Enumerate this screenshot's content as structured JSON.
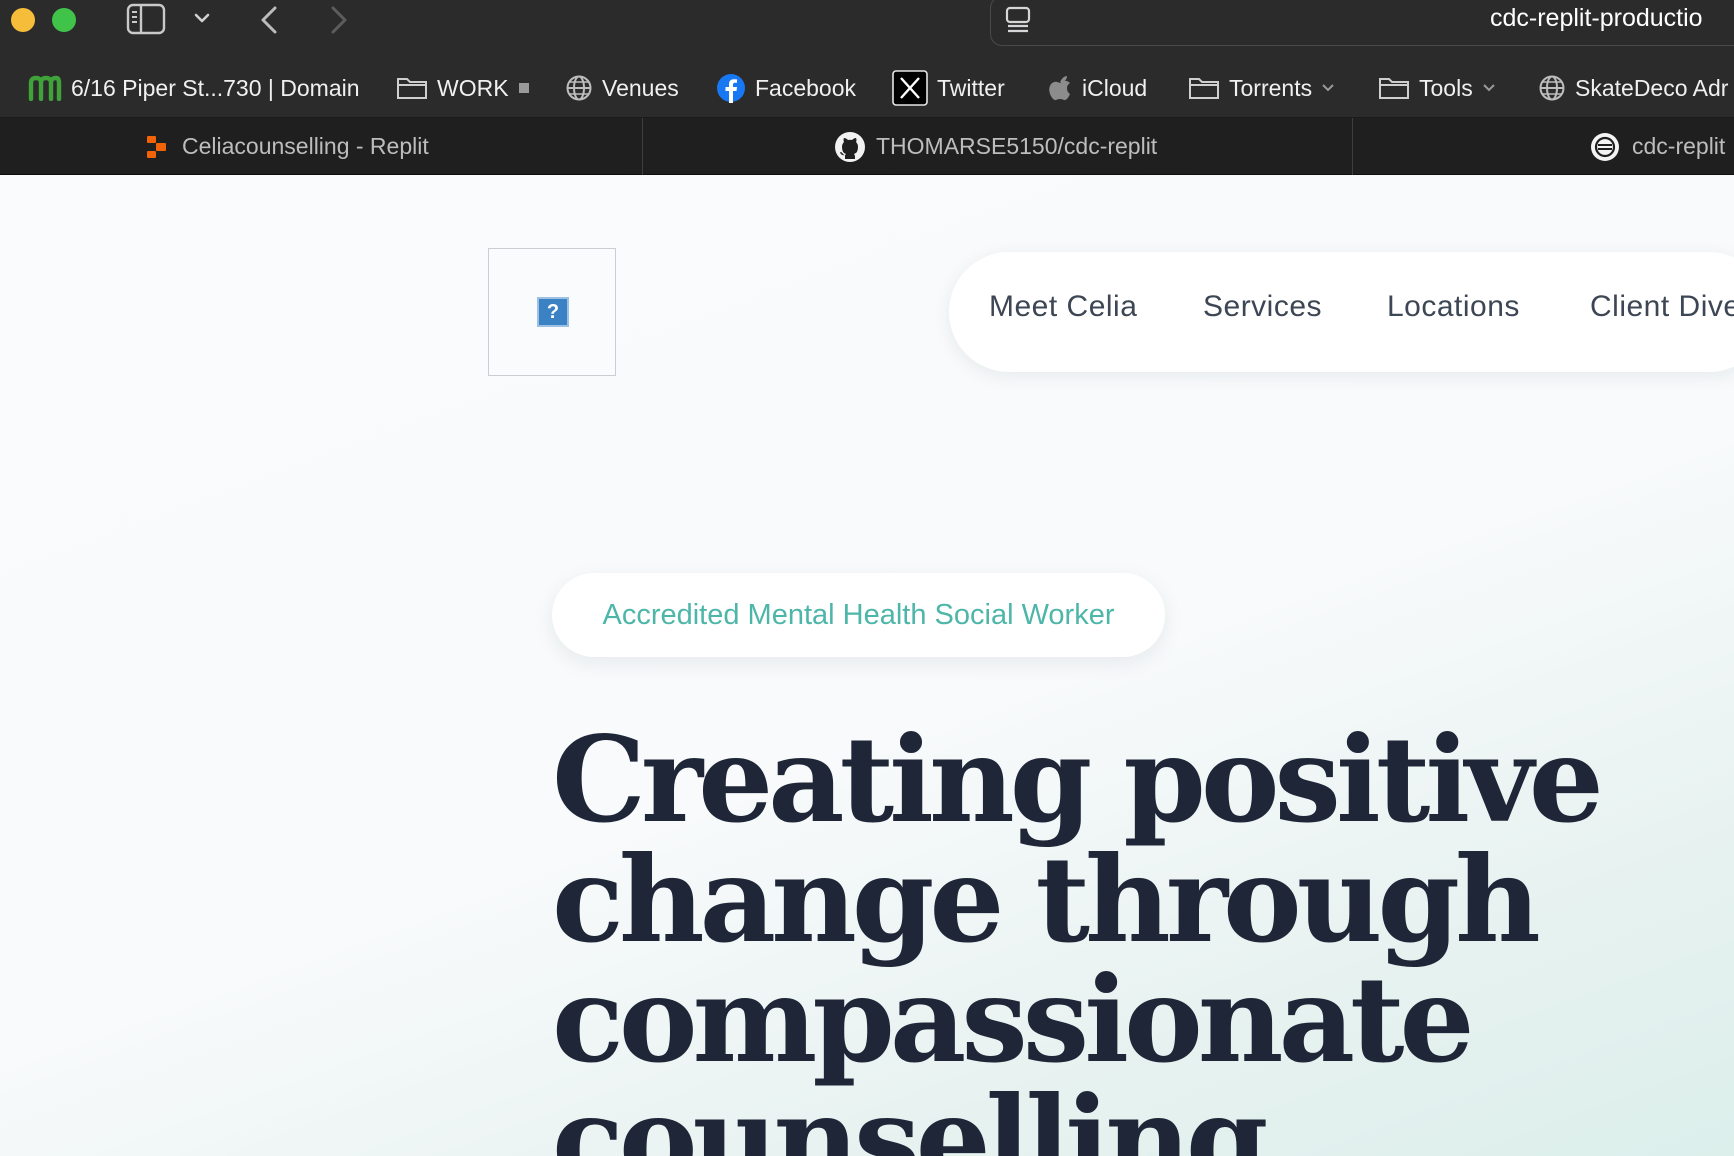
{
  "browser": {
    "address_text": "cdc-replit-productio",
    "bookmarks": [
      {
        "label": "6/16 Piper St...730 | Domain",
        "icon": "domain-m-icon"
      },
      {
        "label": "WORK",
        "icon": "folder-icon"
      },
      {
        "label": "Venues",
        "icon": "globe-icon"
      },
      {
        "label": "Facebook",
        "icon": "facebook-icon"
      },
      {
        "label": "Twitter",
        "icon": "x-twitter-icon"
      },
      {
        "label": "iCloud",
        "icon": "apple-icon"
      },
      {
        "label": "Torrents",
        "icon": "folder-icon"
      },
      {
        "label": "Tools",
        "icon": "folder-icon"
      },
      {
        "label": "SkateDeco Adr",
        "icon": "globe-icon"
      }
    ],
    "tabs": [
      {
        "label": "Celiacounselling - Replit",
        "icon": "replit-icon"
      },
      {
        "label": "THOMARSE5150/cdc-replit",
        "icon": "github-icon"
      },
      {
        "label": "cdc-replit",
        "icon": "site-icon"
      }
    ]
  },
  "site": {
    "nav": [
      "Meet Celia",
      "Services",
      "Locations",
      "Client Dive"
    ],
    "badge": "Accredited Mental Health Social Worker",
    "headline": {
      "line1_word1": "Creating",
      "line1_word2": "positive",
      "line2": "change through",
      "line3": "compassionate",
      "line4": "counselling"
    }
  },
  "colors": {
    "accent": "#4eb6a9",
    "headline": "#1e2638",
    "chrome": "#2b2b2c",
    "tabbar": "#1f1f20"
  }
}
